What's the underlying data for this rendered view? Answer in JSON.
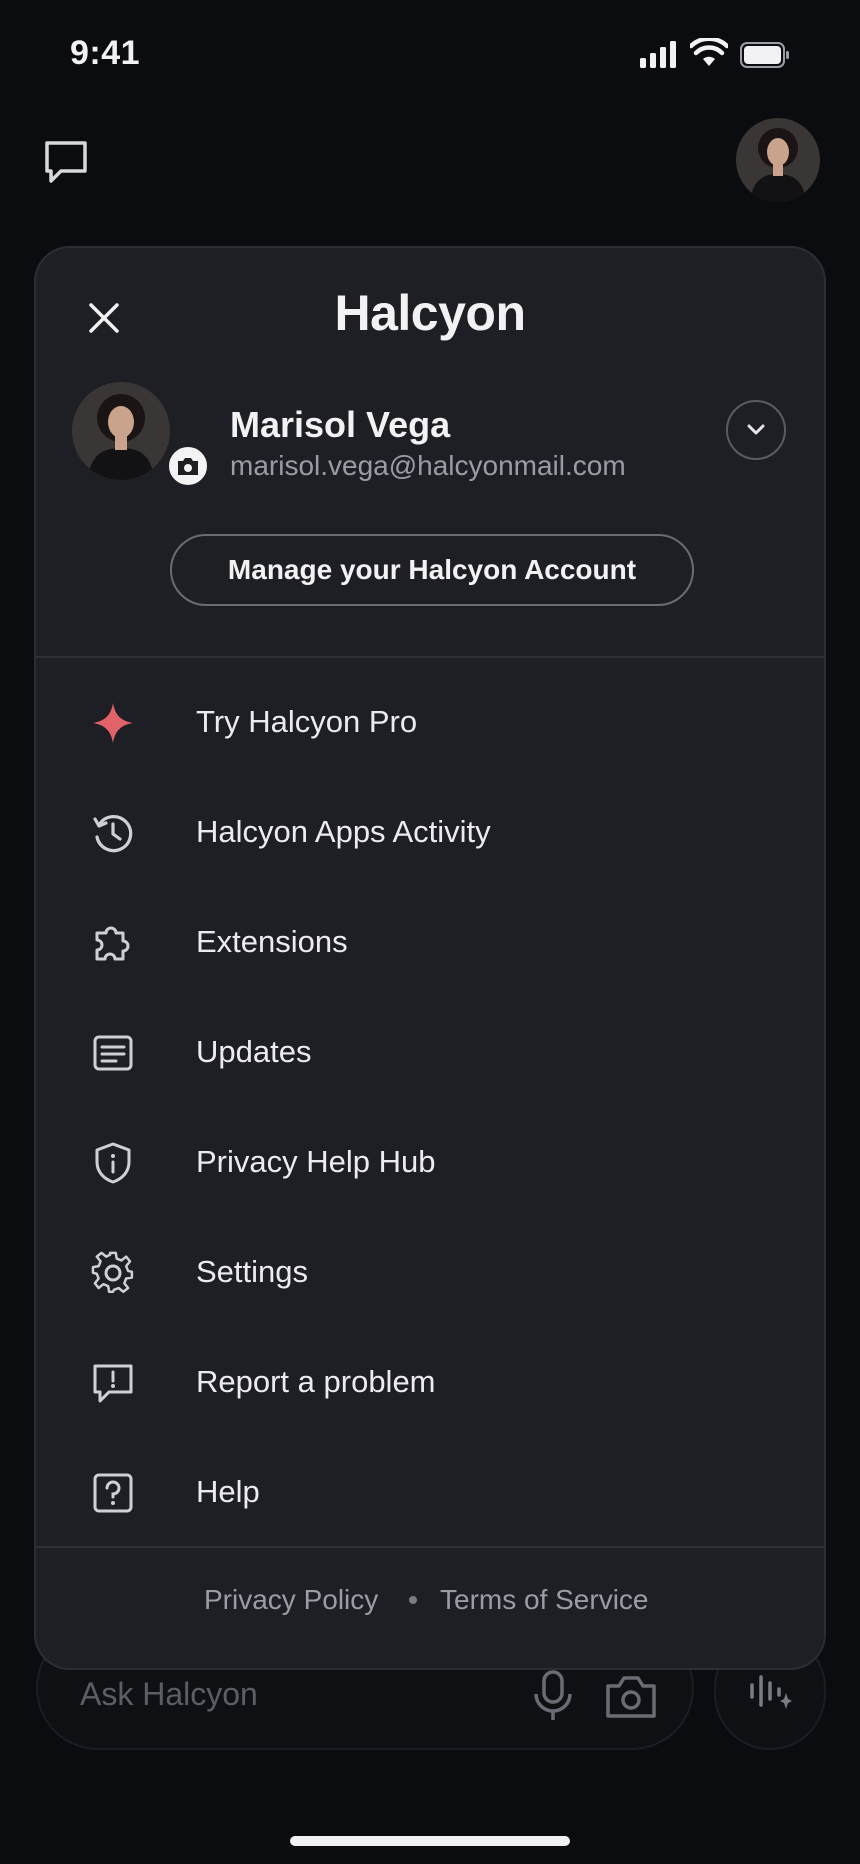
{
  "status_bar": {
    "time": "9:41"
  },
  "background": {
    "ask_placeholder": "Ask Halcyon"
  },
  "sheet": {
    "brand": "Halcyon",
    "account": {
      "name": "Marisol Vega",
      "email": "marisol.vega@halcyonmail.com",
      "manage_label": "Manage your Halcyon Account"
    },
    "menu": [
      {
        "label": "Try Halcyon Pro",
        "icon": "sparkle-icon"
      },
      {
        "label": "Halcyon Apps Activity",
        "icon": "history-icon"
      },
      {
        "label": "Extensions",
        "icon": "puzzle-icon"
      },
      {
        "label": "Updates",
        "icon": "updates-icon"
      },
      {
        "label": "Privacy Help Hub",
        "icon": "shield-info-icon"
      },
      {
        "label": "Settings",
        "icon": "gear-icon"
      },
      {
        "label": "Report a problem",
        "icon": "report-icon"
      },
      {
        "label": "Help",
        "icon": "help-icon"
      }
    ],
    "footer": {
      "privacy": "Privacy Policy",
      "terms": "Terms of Service"
    }
  },
  "colors": {
    "accent_sparkle": "#e2626a",
    "sheet_bg": "#1e1f24",
    "page_bg": "#0b0c0f"
  }
}
